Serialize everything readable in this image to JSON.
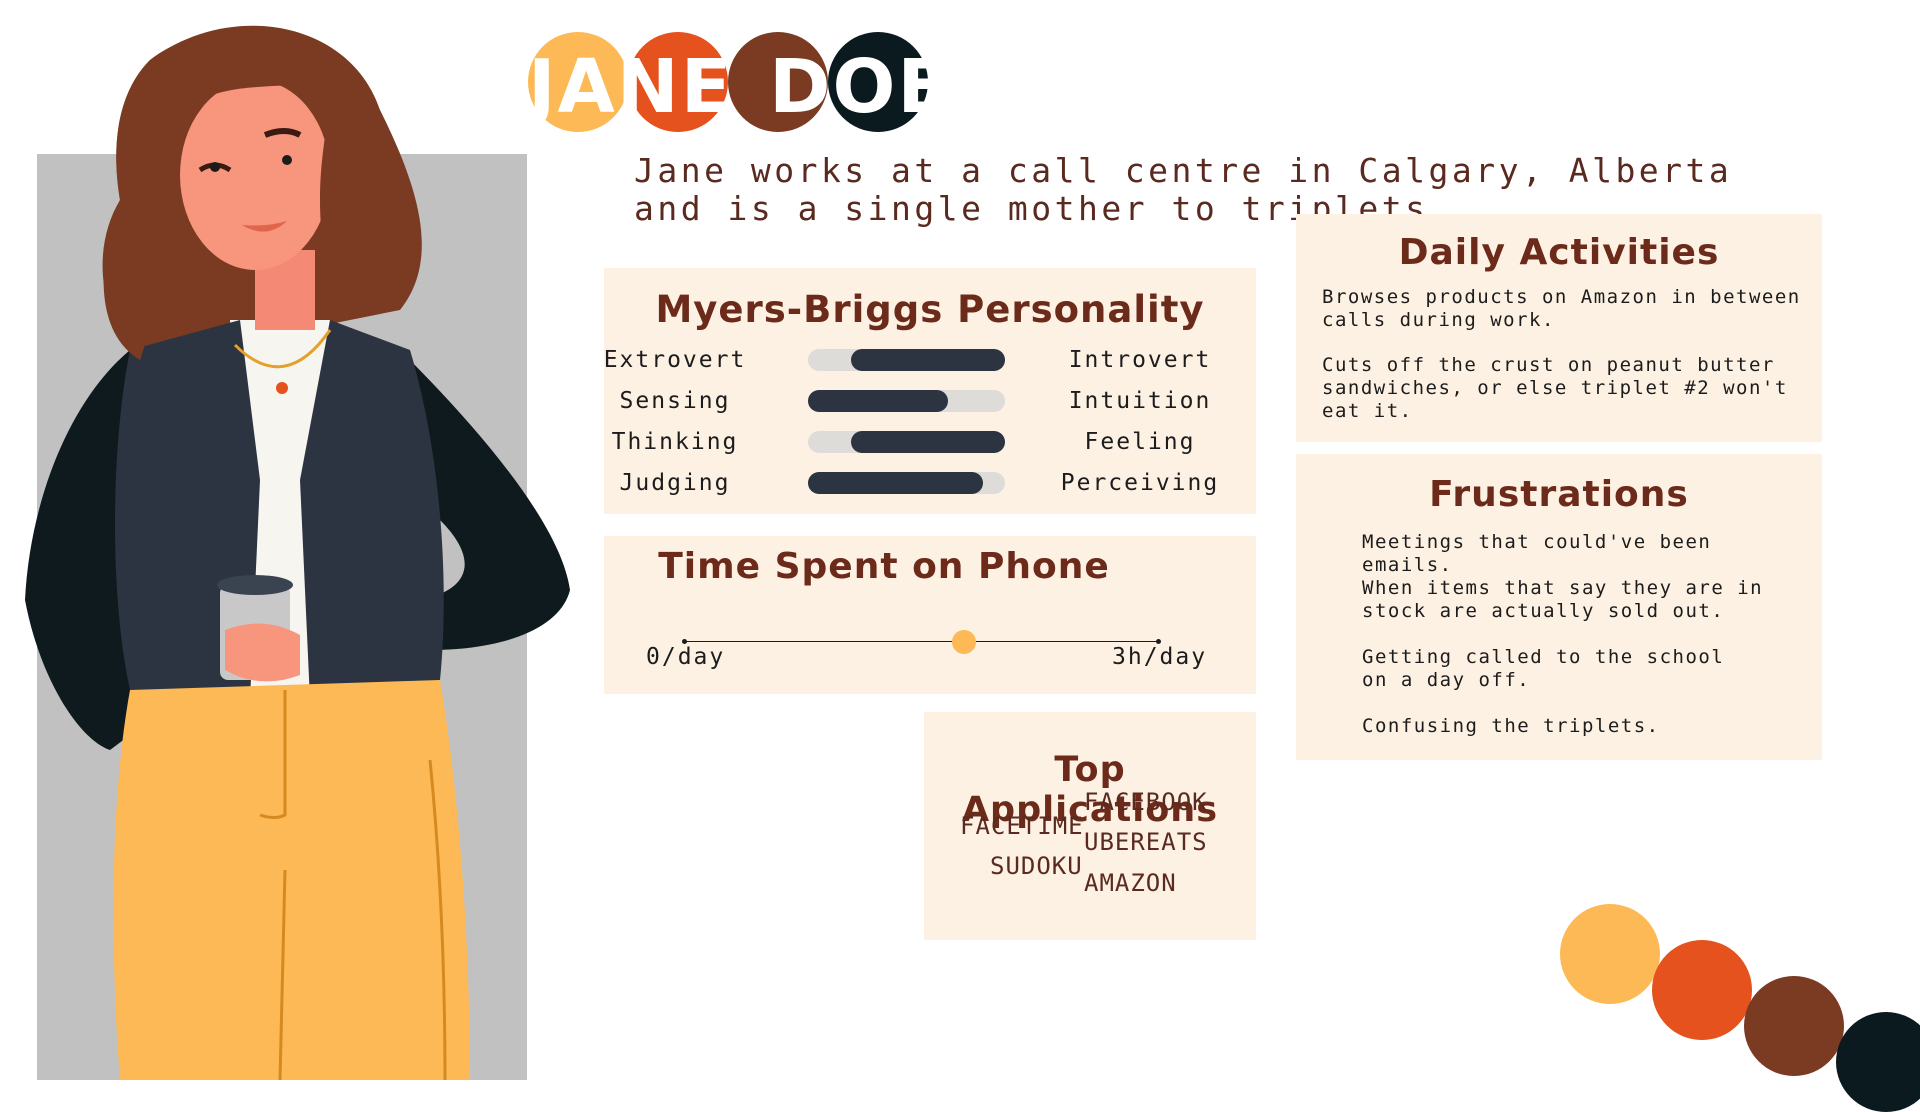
{
  "persona": {
    "name_part1": "JANE",
    "name_part2": "DOE",
    "bio": "Jane works at a call centre in Calgary, Alberta and is a single mother to triplets."
  },
  "colors": {
    "yellow": "#fdb955",
    "orange": "#e5521e",
    "brown": "#7b3a22",
    "dark": "#0b1a1f",
    "panel": "#fdf1e3",
    "accent_text": "#6b2a1a"
  },
  "myers_briggs": {
    "title": "Myers-Briggs Personality",
    "rows": [
      {
        "left": "Extrovert",
        "right": "Introvert",
        "fill_start": 0.22,
        "fill_end": 1.0
      },
      {
        "left": "Sensing",
        "right": "Intuition",
        "fill_start": 0.0,
        "fill_end": 0.71
      },
      {
        "left": "Thinking",
        "right": "Feeling",
        "fill_start": 0.22,
        "fill_end": 1.0
      },
      {
        "left": "Judging",
        "right": "Perceiving",
        "fill_start": 0.0,
        "fill_end": 0.89
      }
    ]
  },
  "phone_time": {
    "title": "Time Spent on Phone",
    "min_label": "0/day",
    "max_label": "3h/day",
    "value_fraction": 0.59
  },
  "top_apps": {
    "title": "Top Applications",
    "left": [
      "FACETIME",
      "SUDOKU"
    ],
    "right": [
      "FACEBOOK",
      "UBEREATS",
      "AMAZON"
    ]
  },
  "daily_activities": {
    "title": "Daily Activities",
    "items": [
      "Browses products on Amazon in between\ncalls during work.",
      "Cuts off the crust on peanut butter\nsandwiches, or else triplet #2 won't\neat it."
    ]
  },
  "frustrations": {
    "title": "Frustrations",
    "items": [
      "Meetings that could've been emails.",
      "When items that say they are in\nstock are actually sold out.",
      "Getting called to the school\non a day off.",
      "Confusing the triplets."
    ]
  }
}
